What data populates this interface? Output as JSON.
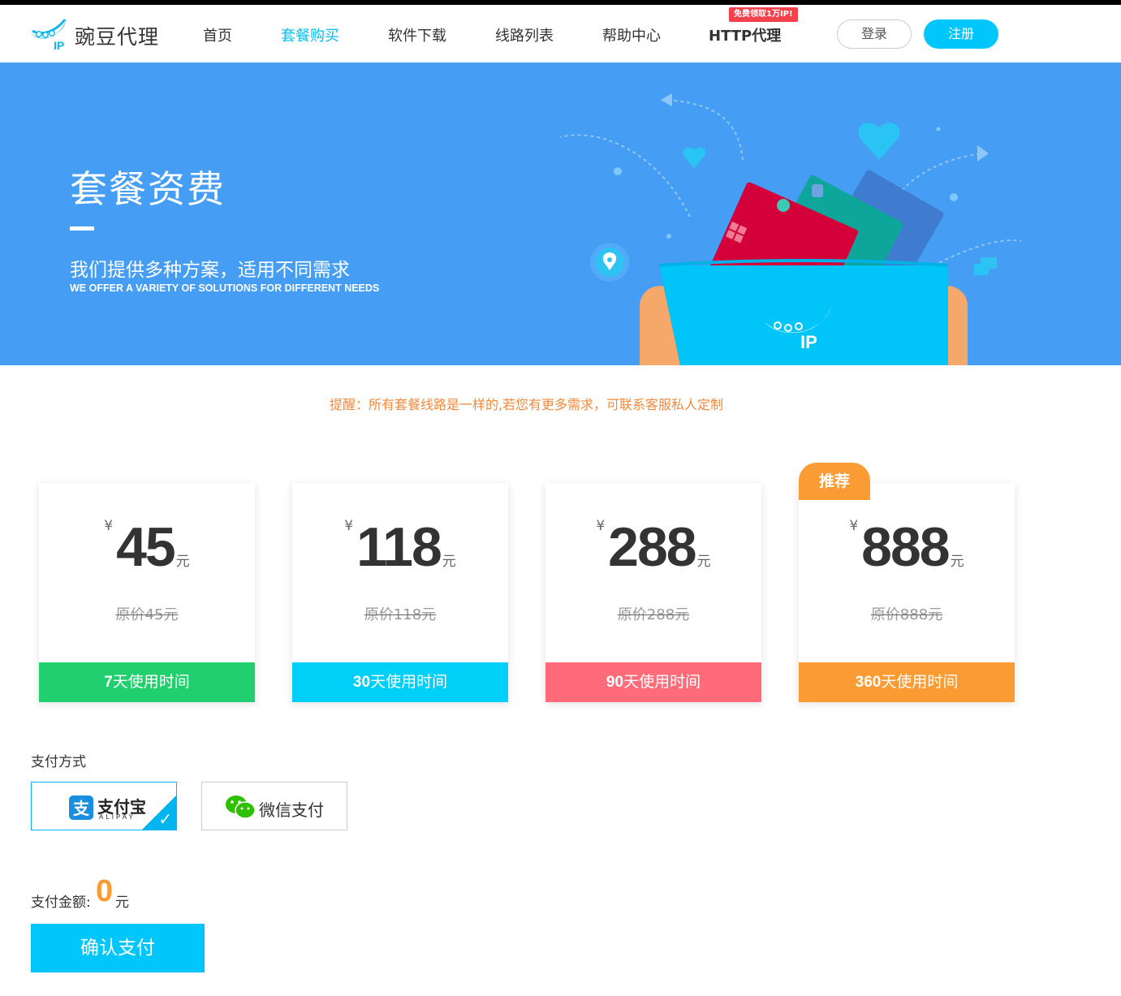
{
  "header": {
    "logo_text": "豌豆代理",
    "nav": [
      {
        "label": "首页",
        "active": false
      },
      {
        "label": "套餐购买",
        "active": true
      },
      {
        "label": "软件下载",
        "active": false
      },
      {
        "label": "线路列表",
        "active": false
      },
      {
        "label": "帮助中心",
        "active": false
      },
      {
        "label": "HTTP代理",
        "active": false
      }
    ],
    "http_badge": "免费领取1万IP!",
    "login_label": "登录",
    "register_label": "注册"
  },
  "banner": {
    "title": "套餐资费",
    "subtitle": "我们提供多种方案，适用不同需求",
    "subtitle_en": "WE OFFER A VARIETY OF SOLUTIONS FOR DIFFERENT NEEDS"
  },
  "notice": "提醒：所有套餐线路是一样的,若您有更多需求，可联系客服私人定制",
  "plans": [
    {
      "currency": "¥",
      "price": "45",
      "unit": "元",
      "original": "原价45元",
      "days": "7",
      "duration_suffix": "天使用时间",
      "color": "#22cf6e"
    },
    {
      "currency": "¥",
      "price": "118",
      "unit": "元",
      "original": "原价118元",
      "days": "30",
      "duration_suffix": "天使用时间",
      "color": "#00cff8"
    },
    {
      "currency": "¥",
      "price": "288",
      "unit": "元",
      "original": "原价288元",
      "days": "90",
      "duration_suffix": "天使用时间",
      "color": "#ff6b78"
    },
    {
      "currency": "¥",
      "price": "888",
      "unit": "元",
      "original": "原价888元",
      "days": "360",
      "duration_suffix": "天使用时间",
      "color": "#fb9b33"
    }
  ],
  "recommend_badge": "推荐",
  "payment": {
    "label": "支付方式",
    "options": [
      {
        "name": "支付宝",
        "sub": "ALIPAY",
        "selected": true,
        "icon": "alipay-logo"
      },
      {
        "name": "微信支付",
        "selected": false,
        "icon": "wechat-logo"
      }
    ],
    "amount_label": "支付金额:",
    "amount_value": "0",
    "amount_unit": "元",
    "confirm_label": "确认支付"
  },
  "colors": {
    "accent": "#00c6fb",
    "banner_bg": "#469df4",
    "notice": "#f3893d",
    "highlight": "#fb9b33"
  }
}
